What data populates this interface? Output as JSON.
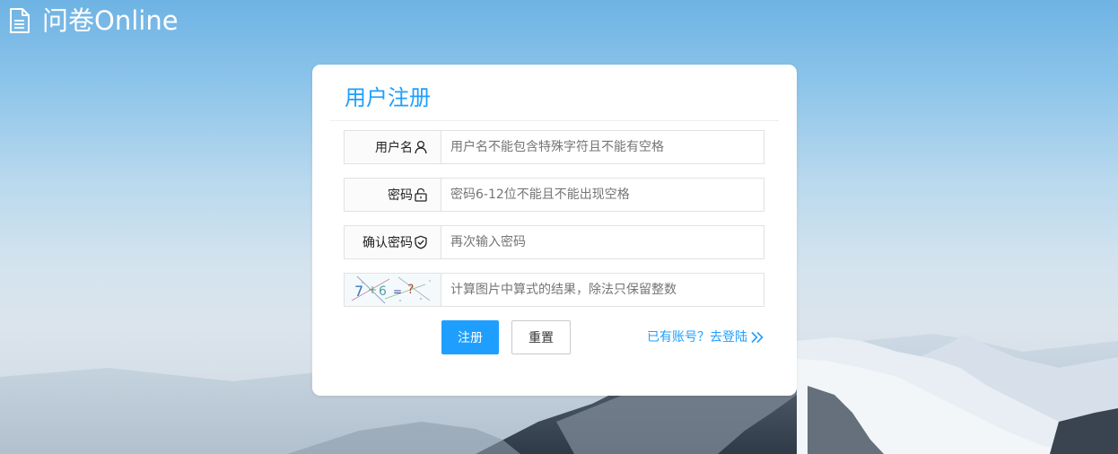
{
  "app": {
    "logo_icon": "document-icon",
    "title": "问卷Online"
  },
  "register": {
    "title": "用户注册",
    "fields": [
      {
        "label": "用户名",
        "icon": "user-icon",
        "placeholder": "用户名不能包含特殊字符且不能有空格",
        "value": ""
      },
      {
        "label": "密码",
        "icon": "lock-icon",
        "placeholder": "密码6-12位不能且不能出现空格",
        "value": ""
      },
      {
        "label": "确认密码",
        "icon": "shield-check-icon",
        "placeholder": "再次输入密码",
        "value": ""
      }
    ],
    "captcha": {
      "image_icon": "captcha-image",
      "placeholder": "计算图片中算式的结果，除法只保留整数",
      "value": ""
    },
    "submit_label": "注册",
    "reset_label": "重置",
    "login_link": "已有账号？去登陆",
    "login_link_icon": "double-chevron-right-icon"
  },
  "colors": {
    "accent": "#1e9fff",
    "card_bg": "#ffffff",
    "sky_top": "#6eb3e4"
  }
}
